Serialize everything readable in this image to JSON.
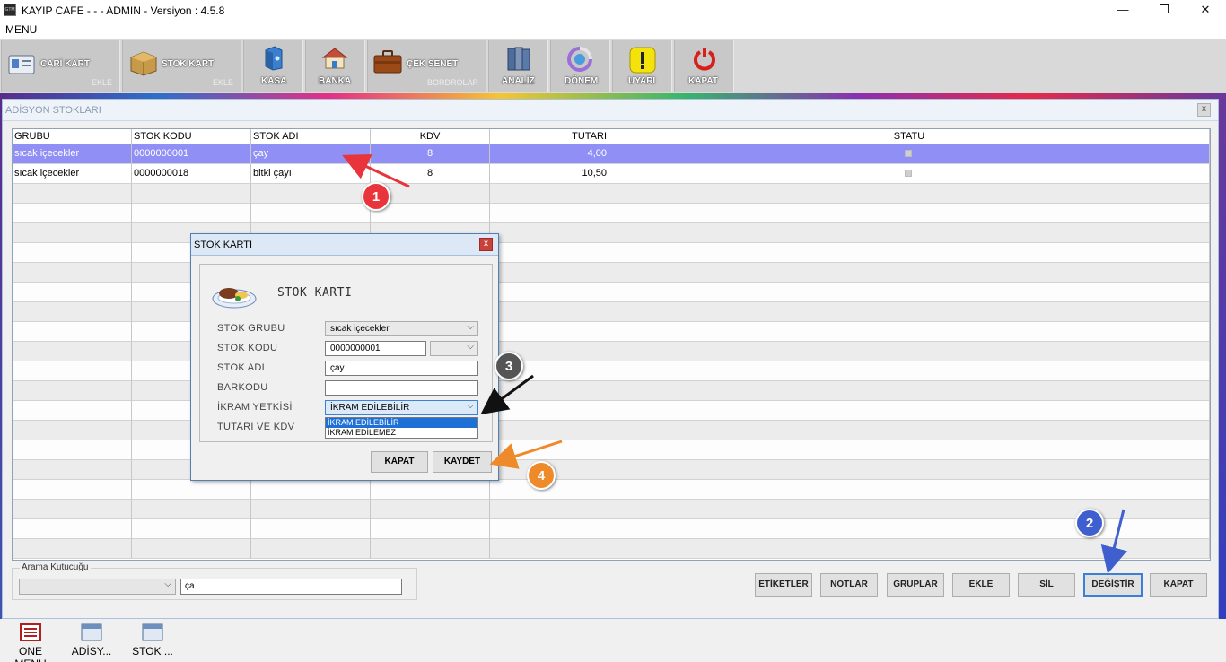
{
  "window": {
    "title": "KAYIP CAFE -  -  - ADMIN -  Versiyon : 4.5.8",
    "app_icon_text": "GTM"
  },
  "menu": {
    "label": "MENU"
  },
  "toolbar": {
    "cari_kart": {
      "label": "CARİ KART",
      "sub": "EKLE"
    },
    "stok_kart": {
      "label": "STOK KART",
      "sub": "EKLE"
    },
    "kasa": {
      "label": "KASA"
    },
    "banka": {
      "label": "BANKA"
    },
    "cek_senet": {
      "label": "ÇEK SENET",
      "sub": "BORDROLAR"
    },
    "analiz": {
      "label": "ANALİZ"
    },
    "donem": {
      "label": "DÖNEM"
    },
    "uyari": {
      "label": "UYARI"
    },
    "kapat": {
      "label": "KAPAT"
    }
  },
  "main": {
    "title": "ADİSYON STOKLARI",
    "columns": [
      "GRUBU",
      "STOK KODU",
      "STOK ADI",
      "KDV",
      "TUTARI",
      "STATU"
    ],
    "rows": [
      {
        "grubu": "sıcak içecekler",
        "kodu": "0000000001",
        "adi": "çay",
        "kdv": "8",
        "tutari": "4,00"
      },
      {
        "grubu": "sıcak içecekler",
        "kodu": "0000000018",
        "adi": "bitki çayı",
        "kdv": "8",
        "tutari": "10,50"
      }
    ],
    "search": {
      "caption": "Arama Kutucuğu",
      "value": "ça"
    },
    "buttons": {
      "etiketler": "ETİKETLER",
      "notlar": "NOTLAR",
      "gruplar": "GRUPLAR",
      "ekle": "EKLE",
      "sil": "SİL",
      "degistir": "DEĞİŞTİR",
      "kapat": "KAPAT"
    }
  },
  "dialog": {
    "title": "STOK KARTI",
    "heading": "STOK KARTI",
    "labels": {
      "grubu": "STOK GRUBU",
      "kodu": "STOK KODU",
      "adi": "STOK ADI",
      "barkodu": "BARKODU",
      "ikram": "İKRAM YETKİSİ",
      "tutar": "TUTARI VE KDV"
    },
    "values": {
      "grubu": "sıcak içecekler",
      "kodu": "0000000001",
      "adi": "çay",
      "barkodu": "",
      "ikram": "İKRAM EDİLEBİLİR"
    },
    "ikram_options": [
      "İKRAM EDİLEBİLİR",
      "İKRAM EDİLEMEZ"
    ],
    "buttons": {
      "kapat": "KAPAT",
      "kaydet": "KAYDET"
    }
  },
  "annotations": {
    "badge1": "1",
    "badge2": "2",
    "badge3": "3",
    "badge4": "4",
    "colors": {
      "red": "#e8343a",
      "blue": "#3f5fcf",
      "black": "#111111",
      "orange": "#ef8a2a"
    }
  },
  "taskbar": {
    "items": [
      "ONE MENU",
      "ADİSY...",
      "STOK ..."
    ]
  }
}
